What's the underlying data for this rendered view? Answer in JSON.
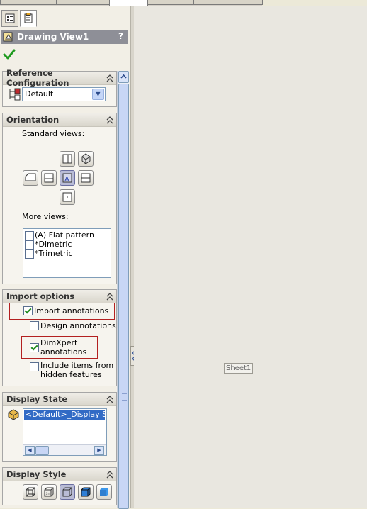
{
  "panel_tabs": [
    {
      "icon": "featuremanager-tree-icon"
    },
    {
      "icon": "propertymanager-icon"
    }
  ],
  "title": "Drawing View1",
  "help_label": "?",
  "icons": {
    "title": "drawing-view-icon",
    "ok": "ok-checkmark-icon",
    "reference_config": "configuration-icon",
    "display_state": "display-state-icon",
    "collapse": "collapse-chevron-icon"
  },
  "reference_configuration": {
    "header": "Reference Configuration",
    "selected": "Default"
  },
  "orientation": {
    "header": "Orientation",
    "standard_views_label": "Standard views:",
    "standard_views": [
      {
        "name": "back-view",
        "icon": "back-view-icon",
        "active": false
      },
      {
        "name": "isometric-view",
        "icon": "isometric-view-icon",
        "active": false
      },
      {
        "name": "left-view",
        "icon": "left-view-icon",
        "active": false
      },
      {
        "name": "front-view",
        "icon": "front-view-icon",
        "active": false
      },
      {
        "name": "right-view",
        "icon": "right-view-icon",
        "active": true
      },
      {
        "name": "top-view",
        "icon": "top-view-icon",
        "active": false
      },
      {
        "name": "bottom-view",
        "icon": "bottom-view-icon",
        "active": false
      }
    ],
    "more_views_label": "More views:",
    "more_views": [
      {
        "label": "(A) Flat pattern",
        "checked": false
      },
      {
        "label": "*Dimetric",
        "checked": false
      },
      {
        "label": "*Trimetric",
        "checked": false
      }
    ]
  },
  "import_options": {
    "header": "Import options",
    "import_annotations": {
      "label": "Import annotations",
      "checked": true
    },
    "design_annotations": {
      "label": "Design annotations",
      "checked": false
    },
    "dimxpert_annotations": {
      "label_line1": "DimXpert",
      "label_line2": "annotations",
      "checked": true
    },
    "include_hidden": {
      "label_line1": "Include items from",
      "label_line2": "hidden features",
      "checked": false
    }
  },
  "display_state": {
    "header": "Display State",
    "items": [
      "<Default>_Display Stat"
    ]
  },
  "display_style": {
    "header": "Display Style",
    "buttons": [
      {
        "name": "wireframe",
        "icon": "wireframe-icon",
        "active": false
      },
      {
        "name": "hidden-lines-visible",
        "icon": "hidden-lines-visible-icon",
        "active": false
      },
      {
        "name": "hidden-lines-removed",
        "icon": "hidden-lines-removed-icon",
        "active": true
      },
      {
        "name": "shaded-with-edges",
        "icon": "shaded-with-edges-icon",
        "active": false
      },
      {
        "name": "shaded",
        "icon": "shaded-icon",
        "active": false
      }
    ]
  },
  "sheet": {
    "label": "Sheet1"
  },
  "colors": {
    "highlight_border": "#b32020",
    "list_selection": "#316ac5",
    "title_bar": "#8e8f97"
  }
}
